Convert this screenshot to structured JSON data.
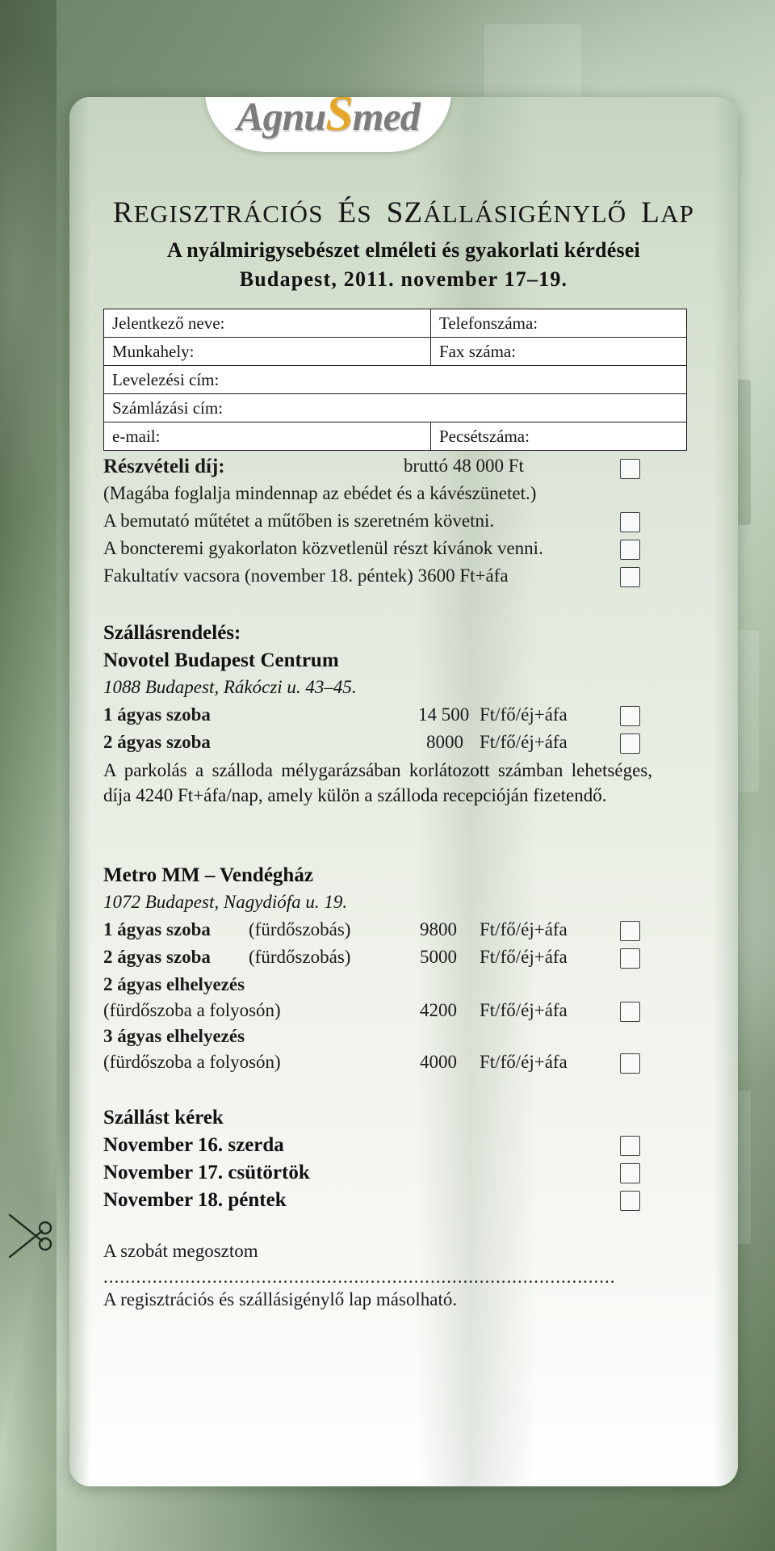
{
  "brand": {
    "logo_part1": "Agnu",
    "logo_mark": "S",
    "logo_part2": "med"
  },
  "header": {
    "title_cap1": "R",
    "title_rest1": "EGISZTRÁCIÓS",
    "title_cap2": "É",
    "title_rest2": "S",
    "title_cap3": "SZ",
    "title_rest3": "ÁLLÁSIGÉNYLŐ",
    "title_cap4": "L",
    "title_rest4": "AP",
    "title_full": "REGISZTRÁCIÓS ÉS SZÁLLÁSIGÉNYLŐ LAP",
    "subtitle_line1": "A nyálmirigysebészet elméleti és gyakorlati kérdései",
    "subtitle_line2": "Budapest, 2011. november 17–19."
  },
  "form_table": {
    "rows": [
      {
        "left": "Jelentkező neve:",
        "right": "Telefonszáma:",
        "split": true
      },
      {
        "left": "Munkahely:",
        "right": "Fax száma:",
        "split": true
      },
      {
        "left": "Levelezési cím:",
        "right": "",
        "split": false
      },
      {
        "left": "Számlázási cím:",
        "right": "",
        "split": false
      },
      {
        "left": "e-mail:",
        "right": "Pecsétszáma:",
        "split": true
      }
    ]
  },
  "fee": {
    "label": "Részvételi díj:",
    "amount": "bruttó 48 000 Ft",
    "note": "(Magába foglalja mindennap az ebédet és a kávészünetet.)",
    "options": [
      "A bemutató műtétet a műtőben is szeretném követni.",
      "A boncteremi gyakorlaton közvetlenül részt kívánok venni.",
      "Fakultatív vacsora (november 18. péntek) 3600 Ft+áfa"
    ],
    "option_lines": [
      "A bemutató műtétet a műtőben is szeretném követni.",
      "A boncteremi gyakorlaton közvetlenül részt kívánok venni.",
      "Fakultatív vacsora (november 18. péntek) 3600 Ft+áfa"
    ]
  },
  "accommodation": {
    "heading": "Szállásrendelés:",
    "hotels": [
      {
        "name": "Novotel Budapest Centrum",
        "address": "1088 Budapest, Rákóczi u. 43–45.",
        "rooms": [
          {
            "label": "1 ágyas szoba",
            "sub": "",
            "price": "14 500",
            "unit": "Ft/fő/éj+áfa"
          },
          {
            "label": "2 ágyas szoba",
            "sub": "",
            "price": "8000",
            "unit": "Ft/fő/éj+áfa"
          }
        ],
        "note": "A parkolás a szálloda mélygarázsában korlátozott számban lehetséges, díja 4240 Ft+áfa/nap, amely külön a szálloda recepcióján fizetendő."
      },
      {
        "name": "Metro MM – Vendégház",
        "address": "1072 Budapest, Nagydiófa u. 19.",
        "rooms": [
          {
            "label": "1 ágyas szoba",
            "sub": "(fürdőszobás)",
            "price": "9800",
            "unit": "Ft/fő/éj+áfa"
          },
          {
            "label": "2 ágyas szoba",
            "sub": "(fürdőszobás)",
            "price": "5000",
            "unit": "Ft/fő/éj+áfa"
          },
          {
            "label": "2 ágyas elhelyezés",
            "sub": "(fürdőszoba a folyosón)",
            "price": "4200",
            "unit": "Ft/fő/éj+áfa"
          },
          {
            "label": "3 ágyas elhelyezés",
            "sub": "(fürdőszoba a folyosón)",
            "price": "4000",
            "unit": "Ft/fő/éj+áfa"
          }
        ],
        "note": ""
      }
    ]
  },
  "nights": {
    "heading": "Szállást kérek",
    "items": [
      "November 16. szerda",
      "November 17. csütörtök",
      "November 18. péntek"
    ]
  },
  "footer": {
    "share_label": "A szobát megosztom",
    "dots": "..............................................................................................",
    "copy_note": "A regisztrációs és szállásigénylő lap másolható."
  },
  "colors": {
    "bg_green_dark": "#59704f",
    "bg_green_light": "#cfdcc9",
    "card_white": "#ffffff",
    "logo_gray": "#7c7c7c",
    "logo_accent": "#e8a628",
    "text": "#141414"
  }
}
